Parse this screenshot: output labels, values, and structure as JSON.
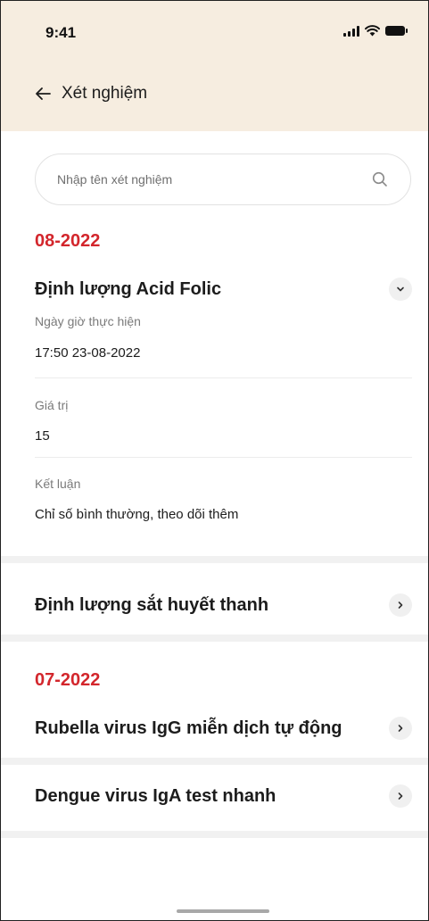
{
  "status_bar": {
    "time": "9:41"
  },
  "nav": {
    "title": "Xét nghiệm"
  },
  "search": {
    "placeholder": "Nhập tên xét nghiệm"
  },
  "groups": [
    {
      "month": "08-2022",
      "tests": [
        {
          "name": "Định lượng Acid Folic",
          "expanded": true,
          "fields": [
            {
              "label": "Ngày giờ thực hiện",
              "value": "17:50 23-08-2022"
            },
            {
              "label": "Giá trị",
              "value": "15"
            },
            {
              "label": "Kết luận",
              "value": "Chỉ số bình thường, theo dõi thêm"
            }
          ]
        },
        {
          "name": "Định lượng sắt huyết thanh",
          "expanded": false
        }
      ]
    },
    {
      "month": "07-2022",
      "tests": [
        {
          "name": "Rubella virus IgG miễn dịch tự động",
          "expanded": false
        },
        {
          "name": "Dengue virus IgA test nhanh",
          "expanded": false
        }
      ]
    }
  ],
  "colors": {
    "header_bg": "#f6ede0",
    "accent_red": "#d3262c"
  }
}
